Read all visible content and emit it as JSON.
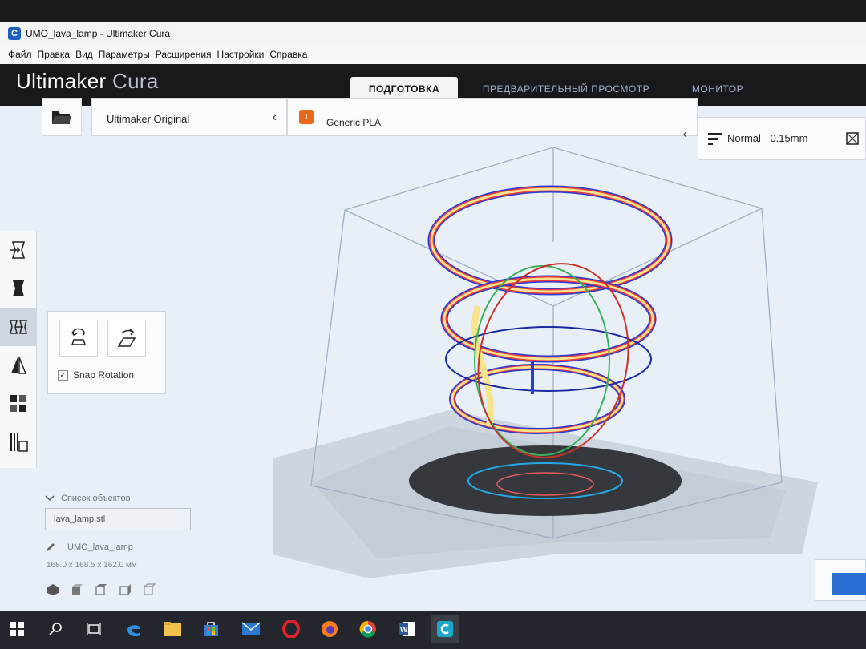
{
  "window": {
    "title": "UMO_lava_lamp - Ultimaker Cura",
    "app_icon_letter": "C"
  },
  "menu": [
    "Файл",
    "Правка",
    "Вид",
    "Параметры",
    "Расширения",
    "Настройки",
    "Справка"
  ],
  "brand": {
    "primary": "Ultimaker",
    "secondary": "Cura"
  },
  "stages": {
    "prepare": "ПОДГОТОВКА",
    "preview": "ПРЕДВАРИТЕЛЬНЫЙ ПРОСМОТР",
    "monitor": "МОНИТОР"
  },
  "printer": {
    "name": "Ultimaker Original"
  },
  "material": {
    "extruder_number": "1",
    "name": "Generic PLA"
  },
  "profile": {
    "name": "Normal - 0.15mm"
  },
  "rotate_panel": {
    "snap_label": "Snap Rotation",
    "snap_checked": true
  },
  "object_list": {
    "header": "Список объектов",
    "item": "lava_lamp.stl",
    "job_name": "UMO_lava_lamp",
    "dimensions": "168.0 x 168.5 x 162.0 мм"
  },
  "colors": {
    "accent": "#2a6fd6",
    "material_badge": "#e56a1c",
    "header_bg": "#18191d"
  },
  "icons": [
    "folder-icon",
    "chevron-left-icon",
    "profile-bars-icon",
    "settings-icon",
    "move-icon",
    "scale-icon",
    "rotate-icon",
    "mirror-icon",
    "per-model-settings-icon",
    "support-blocker-icon",
    "reset-rotation-icon",
    "lay-flat-icon",
    "edit-pencil-icon",
    "3d-view-icon",
    "windows-start-icon",
    "search-icon",
    "task-view-icon",
    "edge-icon",
    "explorer-icon",
    "store-icon",
    "mail-icon",
    "opera-icon",
    "firefox-icon",
    "chrome-icon",
    "word-icon",
    "cura-icon"
  ]
}
